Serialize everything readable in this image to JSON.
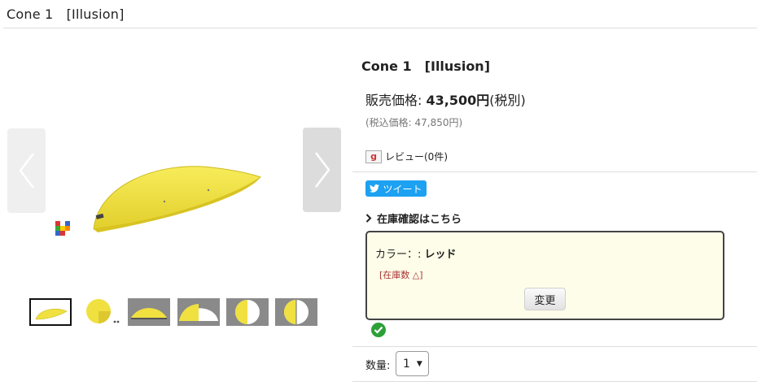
{
  "page": {
    "header_title": "Cone 1　[Illusion]"
  },
  "gallery": {
    "prev_label": "previous",
    "next_label": "next",
    "thumbnail_count": 6,
    "active_thumbnail": 1
  },
  "product": {
    "name": "Cone 1　[Illusion]",
    "price_prefix": "販売価格:",
    "price_amount": "43,500円",
    "price_suffix": "(税別)",
    "tax_included": "(税込価格: 47,850円)",
    "review_icon": "g",
    "review_text": "レビュー(0件)",
    "tweet_label": "ツイート",
    "stock_link": "在庫確認はこちら",
    "option_label": "カラー：:",
    "option_value": "レッド",
    "option_stock": "[在庫数 △]",
    "change_button": "変更",
    "quantity_label": "数量:",
    "quantity_value": "1"
  },
  "colors": {
    "accent_yellow": "#f0e040",
    "tweet_blue": "#1da1f2",
    "option_bg": "#fdfde9",
    "check_green": "#2ea03a"
  }
}
